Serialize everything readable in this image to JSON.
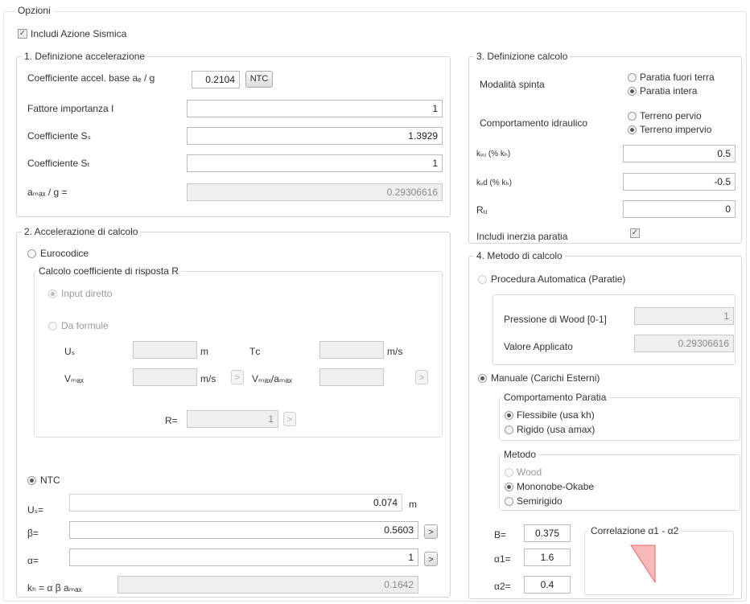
{
  "options_title": "Opzioni",
  "include_seismic": {
    "label": "Includi Azione Sismica",
    "checked": true
  },
  "section1": {
    "title": "1. Definizione accelerazione",
    "accel_base_label": "Coefficiente accel. base aₑ / g",
    "accel_base_value": "0.2104",
    "ntc_button": "NTC",
    "fattore_label": "Fattore importanza I",
    "fattore_value": "1",
    "ss_label": "Coefficiente Sₛ",
    "ss_value": "1.3929",
    "st_label": "Coefficiente Sₜ",
    "st_value": "1",
    "amax_label": "aₘₐₓ / g =",
    "amax_value": "0.29306616"
  },
  "section2": {
    "title": "2. Accelerazione di calcolo",
    "eurocodice_label": "Eurocodice",
    "calcolo_r_title": "Calcolo coefficiente di risposta R",
    "input_diretto": "Input diretto",
    "da_formule": "Da formule",
    "us_label": "Uₛ",
    "us_unit": "m",
    "tc_label": "Tᴄ",
    "tc_unit": "m/s",
    "vmax_label": "Vₘₐₓ",
    "vmax_unit": "m/s",
    "vmax_amax_label": "Vₘₐₓ/aₘₐₓ",
    "r_label": "R=",
    "r_value": "1",
    "ntc_label": "NTC",
    "us_eq_label": "Uₛ=",
    "us_eq_value": "0.074",
    "us_eq_unit": "m",
    "beta_label": "β=",
    "beta_value": "0.5603",
    "alpha_label": "α=",
    "alpha_value": "1",
    "kh_label": "kₕ = α β aₘₐₓ",
    "kh_value": "0.1642",
    "arrow": ">"
  },
  "section3": {
    "title": "3. Definizione calcolo",
    "spinta_label": "Modalità spinta",
    "paratia_fuori": "Paratia fuori terra",
    "paratia_intera": "Paratia intera",
    "idraulico_label": "Comportamento idraulico",
    "terreno_pervio": "Terreno pervio",
    "terreno_impervio": "Terreno impervio",
    "kvu_label": "kᵥᵤ (% kₕ)",
    "kvu_value": "0.5",
    "kvd_label": "kᵥd (% kₕ)",
    "kvd_value": "-0.5",
    "ru_label": "Rᵤ",
    "ru_value": "0",
    "inerzia_label": "Includi inerzia paratia"
  },
  "section4": {
    "title": "4. Metodo di calcolo",
    "procedura_auto": "Procedura Automatica (Paratie)",
    "pressione_wood_label": "Pressione di Wood [0-1]",
    "pressione_wood_value": "1",
    "valore_applicato_label": "Valore Applicato",
    "valore_applicato_value": "0.29306616",
    "manuale": "Manuale (Carichi Esterni)",
    "comportamento_title": "Comportamento Paratia",
    "flessibile": "Flessibile (usa kh)",
    "rigido": "Rigido (usa amax)",
    "metodo_title": "Metodo",
    "wood": "Wood",
    "mononobe": "Mononobe-Okabe",
    "semirigido": "Semirigido",
    "b_label": "B=",
    "b_value": "0.375",
    "a1_label": "α1=",
    "a1_value": "1.6",
    "a2_label": "α2=",
    "a2_value": "0.4",
    "correlazione_title": "Correlazione α1 - α2"
  },
  "colors": {
    "triangle_fill": "#f6b8b8",
    "triangle_stroke": "#e06a6a"
  }
}
